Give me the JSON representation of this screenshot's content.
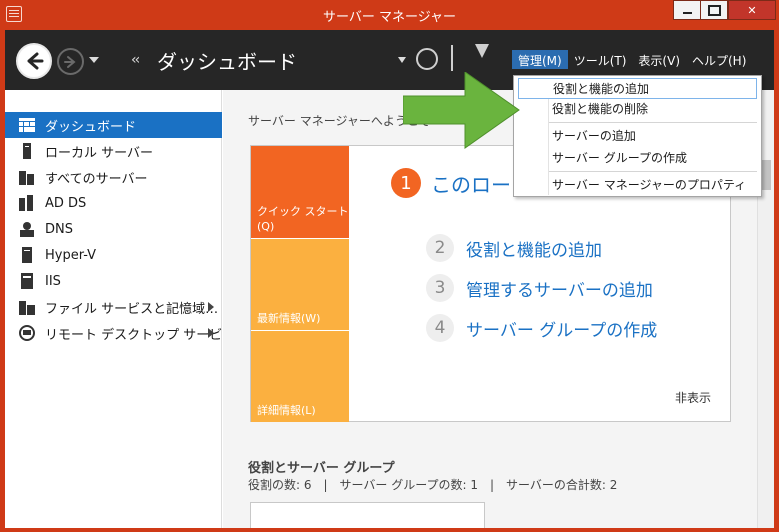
{
  "window": {
    "title": "サーバー マネージャー"
  },
  "header": {
    "breadcrumb": "ダッシュボード",
    "menus": [
      {
        "label": "管理(M)",
        "active": true
      },
      {
        "label": "ツール(T)",
        "active": false
      },
      {
        "label": "表示(V)",
        "active": false
      },
      {
        "label": "ヘルプ(H)",
        "active": false
      }
    ]
  },
  "dropdown": {
    "items": [
      {
        "label": "役割と機能の追加",
        "hover": true
      },
      {
        "label": "役割と機能の削除"
      },
      {
        "label": "サーバーの追加"
      },
      {
        "label": "サーバー グループの作成"
      },
      {
        "label": "サーバー マネージャーのプロパティ"
      }
    ]
  },
  "sidebar": {
    "items": [
      {
        "label": "ダッシュボード",
        "icon": "dashboard-icon",
        "selected": true
      },
      {
        "label": "ローカル サーバー",
        "icon": "local-server-icon"
      },
      {
        "label": "すべてのサーバー",
        "icon": "all-servers-icon"
      },
      {
        "label": "AD DS",
        "icon": "ad-ds-icon"
      },
      {
        "label": "DNS",
        "icon": "dns-icon"
      },
      {
        "label": "Hyper-V",
        "icon": "hyper-v-icon"
      },
      {
        "label": "IIS",
        "icon": "iis-icon"
      },
      {
        "label": "ファイル サービスと記憶域…",
        "icon": "file-services-icon",
        "expandable": true
      },
      {
        "label": "リモート デスクトップ サービス",
        "icon": "remote-desktop-icon",
        "expandable": true
      }
    ]
  },
  "main": {
    "welcome": "サーバー マネージャーへようこそ",
    "tiles": {
      "quick_start": "クイック スタート\n(Q)",
      "whats_new": "最新情報(W)",
      "learn_more": "詳細情報(L)"
    },
    "step1": {
      "number": "1",
      "text": "このロー"
    },
    "steps": [
      {
        "number": "2",
        "text": "役割と機能の追加"
      },
      {
        "number": "3",
        "text": "管理するサーバーの追加"
      },
      {
        "number": "4",
        "text": "サーバー グループの作成"
      }
    ],
    "hide": "非表示",
    "roles_title": "役割とサーバー グループ",
    "roles_stats": "役割の数: 6　|　サーバー グループの数: 1　|　サーバーの合計数: 2"
  },
  "colors": {
    "titlebar": "#cf3a17",
    "header": "#262626",
    "accent_blue": "#1a71c4",
    "tile_orange": "#f26522",
    "tile_amber": "#fbb040",
    "pointer_green": "#6ab43e"
  }
}
